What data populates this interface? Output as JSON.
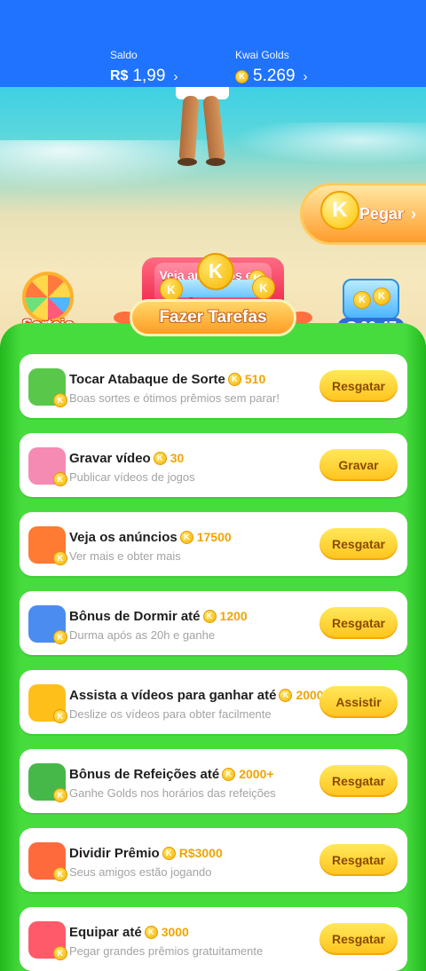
{
  "header": {
    "saldo": {
      "caption": "Saldo",
      "currency": "R$",
      "value": "1,99",
      "chevron": "›"
    },
    "golds": {
      "caption": "Kwai Golds",
      "value": "5.269",
      "chevron": "›"
    }
  },
  "scene": {
    "pegar": {
      "label": "Pegar",
      "chevron": "›"
    },
    "ads_button": {
      "label": "Veja anúncios e ganhe"
    },
    "sorteio": {
      "label": "Sorteio"
    },
    "timer": {
      "value": "00:47"
    }
  },
  "banner": {
    "title": "Fazer Tarefas"
  },
  "coin_glyph": "K",
  "tasks": [
    {
      "title": "Tocar Atabaque de Sorte",
      "reward": "510",
      "subtitle": "Boas sortes e ótimos prêmios sem parar!",
      "button": "Resgatar",
      "icon": "drum-icon",
      "icon_color": "#59c84a"
    },
    {
      "title": "Gravar vídeo",
      "reward": "30",
      "subtitle": "Publicar vídeos de jogos",
      "button": "Gravar",
      "icon": "camera-icon",
      "icon_color": "#f58bb3"
    },
    {
      "title": "Veja os anúncios",
      "reward": "17500",
      "subtitle": "Ver mais e obter mais",
      "button": "Resgatar",
      "icon": "tv-icon",
      "icon_color": "#ff7a32"
    },
    {
      "title": "Bônus de Dormir até",
      "reward": "1200",
      "subtitle": "Durma após as 20h e ganhe",
      "button": "Resgatar",
      "icon": "moon-icon",
      "icon_color": "#4a8cf0"
    },
    {
      "title": "Assista a vídeos para ganhar até",
      "reward": "2000",
      "subtitle": "Deslize os vídeos para obter facilmente",
      "button": "Assistir",
      "icon": "video-camera-icon",
      "icon_color": "#ffbf1a"
    },
    {
      "title": "Bônus de Refeições até",
      "reward": "2000+",
      "subtitle": "Ganhe Golds nos horários das refeições",
      "button": "Resgatar",
      "icon": "calendar-icon",
      "icon_color": "#46b84a"
    },
    {
      "title": "Dividir Prêmio",
      "reward": "R$3000",
      "subtitle": "Seus amigos estão jogando",
      "button": "Resgatar",
      "icon": "gift-icon",
      "icon_color": "#ff6a3d"
    },
    {
      "title": "Equipar até",
      "reward": "3000",
      "subtitle": "Pegar grandes prêmios gratuitamente",
      "button": "Resgatar",
      "icon": "boxing-glove-icon",
      "icon_color": "#ff5a6a"
    }
  ],
  "colors": {
    "header": "#1f73ff",
    "panel": "#47dc3e",
    "button": "#ffd22e",
    "reward": "#f0a500"
  }
}
